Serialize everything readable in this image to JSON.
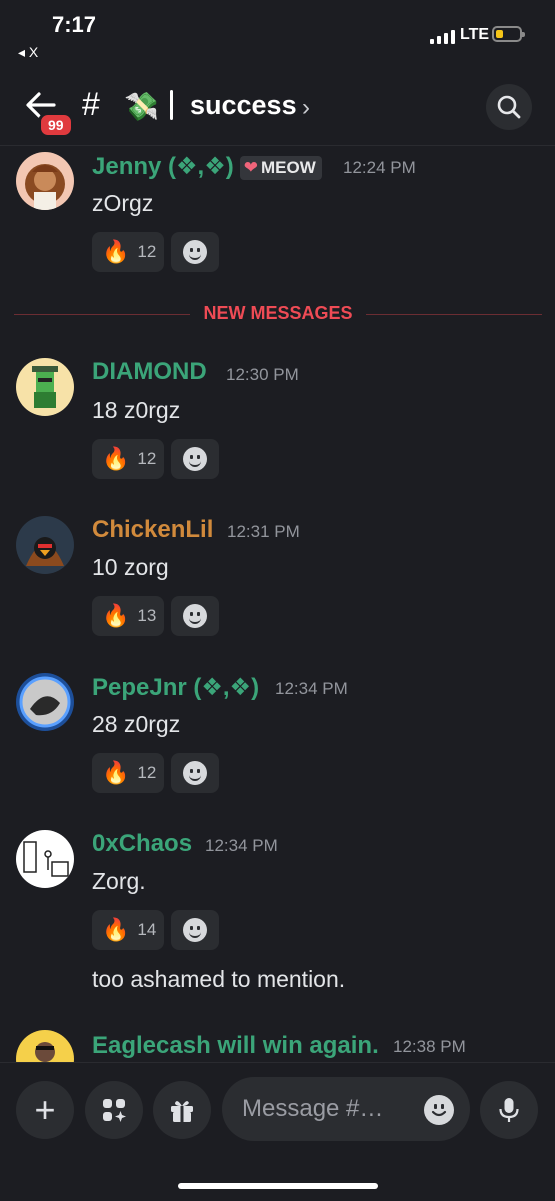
{
  "status_bar": {
    "time": "7:17",
    "back_app": "◂ X",
    "network": "LTE",
    "battery_level": 0.25
  },
  "header": {
    "unread_badge": "99",
    "channel_prefix": "#",
    "channel_emoji": "💸",
    "channel_name": "success",
    "chevron": "›",
    "search_icon": "search-icon"
  },
  "divider": {
    "label": "NEW MESSAGES"
  },
  "messages": [
    {
      "username": "Jenny (❖,❖)",
      "tag": "MEOW",
      "time": "12:24 PM",
      "text": "zOrgz",
      "reaction": {
        "emoji": "🔥",
        "count": "12"
      },
      "name_color": "#3ba579"
    },
    {
      "username": "DIAMOND",
      "time": "12:30 PM",
      "text": "18 z0rgz",
      "reaction": {
        "emoji": "🔥",
        "count": "12"
      },
      "name_color": "#3ba579"
    },
    {
      "username": "ChickenLil",
      "time": "12:31 PM",
      "text": "10 zorg",
      "reaction": {
        "emoji": "🔥",
        "count": "13"
      },
      "name_color": "#d18a3c"
    },
    {
      "username": "PepeJnr (❖,❖)",
      "time": "12:34 PM",
      "text": "28 z0rgz",
      "reaction": {
        "emoji": "🔥",
        "count": "12"
      },
      "name_color": "#3ba579"
    },
    {
      "username": "0xChaos",
      "time": "12:34 PM",
      "text": "Zorg.",
      "followup": "too ashamed to mention.",
      "reaction": {
        "emoji": "🔥",
        "count": "14"
      },
      "name_color": "#3ba579"
    },
    {
      "username": "Eaglecash will win again.",
      "time": "12:38 PM",
      "name_color": "#3ba579"
    }
  ],
  "composer": {
    "placeholder": "Message #…"
  }
}
